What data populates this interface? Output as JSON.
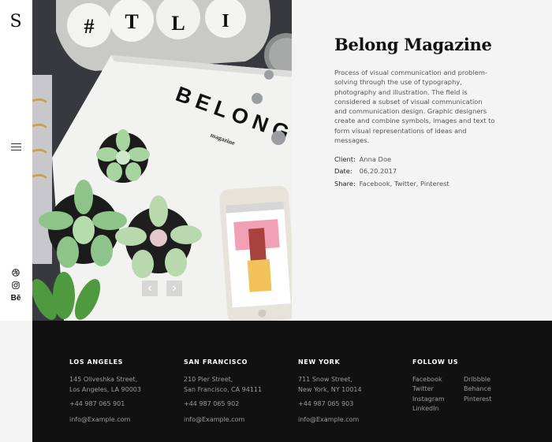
{
  "sidebar": {
    "logo": "S",
    "menu_icon": "hamburger-icon",
    "social_icons": [
      "dribbble-icon",
      "instagram-icon",
      "behance-icon"
    ],
    "behance_text": "Bē"
  },
  "hero": {
    "slider_prev_icon": "chevron-left-icon",
    "slider_next_icon": "chevron-right-icon"
  },
  "project": {
    "title": "Belong Magazine",
    "description": "Process of visual communication and problem-solving through the use of typography, photography and illustration. The field is considered a subset of visual communication and communication design. Graphic designers create and combine symbols, images and text to form visual representations of ideas and messages.",
    "client_label": "Client:",
    "client_value": "Anna Doe",
    "date_label": "Date:",
    "date_value": "06.20.2017",
    "share_label": "Share:",
    "share_links": [
      "Facebook",
      "Twitter",
      "Pinterest"
    ]
  },
  "footer": {
    "la": {
      "heading": "LOS ANGELES",
      "addr1": "145 Oliveshka Street,",
      "addr2": "Los Angeles, LA 90003",
      "phone": "+44 987 065 901",
      "email": "info@Example.com"
    },
    "sf": {
      "heading": "SAN FRANCISCO",
      "addr1": "210 Pier Street,",
      "addr2": "San Francisco, CA 94111",
      "phone": "+44 987 065 902",
      "email": "info@Example.com"
    },
    "ny": {
      "heading": "NEW YORK",
      "addr1": "711 Snow Street,",
      "addr2": "New York, NY 10014",
      "phone": "+44 987 065 903",
      "email": "info@Example.com"
    },
    "follow": {
      "heading": "FOLLOW US",
      "col1": [
        "Facebook",
        "Twitter",
        "Instagram",
        "LinkedIn"
      ],
      "col2": [
        "Dribbble",
        "Behance",
        "Pinterest"
      ]
    }
  },
  "colors": {
    "footer_bg": "#111111",
    "page_bg": "#f4f4f4",
    "accent_text": "#111111"
  }
}
